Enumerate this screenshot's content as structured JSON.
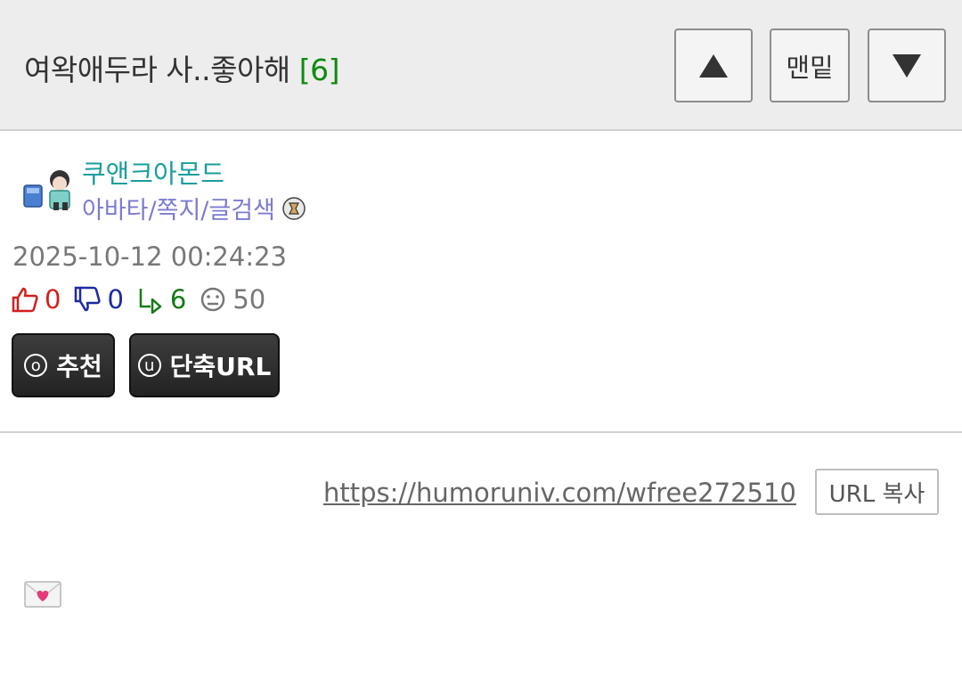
{
  "header": {
    "title": "여왁애두라 사..좋아해",
    "comment_count": "[6]",
    "up_icon": "triangle-up-icon",
    "bottom_label": "맨밑",
    "down_icon": "triangle-down-icon"
  },
  "author": {
    "avatar_icon": "avatar-icon",
    "name": "쿠앤크아몬드",
    "links": "아바타/쪽지/글검색",
    "level_icon": "level-badge-icon"
  },
  "post": {
    "datetime": "2025-10-12 00:24:23",
    "stats": {
      "recommend": "0",
      "oppose": "0",
      "replies": "6",
      "views": "50"
    }
  },
  "actions": {
    "recommend_key": "o",
    "recommend_label": "추천",
    "shorturl_key": "u",
    "shorturl_label": "단축URL"
  },
  "share": {
    "url": "https://humoruniv.com/wfree272510",
    "copy_label": "URL 복사"
  },
  "content": {
    "emoji_icon": "love-letter-icon"
  },
  "colors": {
    "header_bg": "#ededed",
    "count_green": "#0e8a0e",
    "author_teal": "#1a9e9e",
    "links_purple": "#7b7bd1",
    "recommend_red": "#d21f1f",
    "oppose_blue": "#1b2aa0",
    "reply_green": "#167a16"
  }
}
